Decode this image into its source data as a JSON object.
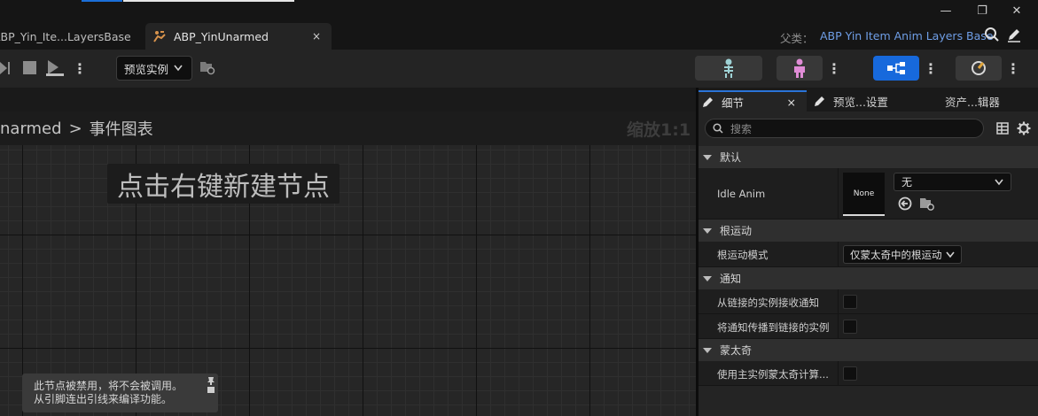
{
  "tabs": [
    {
      "label": "ABP_Yin_Ite...LayersBase"
    },
    {
      "label": "ABP_YinUnarmed",
      "close": "×"
    }
  ],
  "parent_class": {
    "label": "父类：",
    "value": "ABP Yin Item Anim Layers Base"
  },
  "window_controls": {
    "minimize": "—",
    "maximize": "❐",
    "close": "✕"
  },
  "toolbar": {
    "preview_instance": "预览实例"
  },
  "graph": {
    "breadcrumb_asset": "narmed",
    "breadcrumb_sep": ">",
    "breadcrumb_graph": "事件图表",
    "zoom": "缩放1:1",
    "hint": "点击右键新建节点",
    "notice_line1": "此节点被禁用，将不会被调用。",
    "notice_line2": "从引脚连出引线来编译功能。"
  },
  "details_panel": {
    "tabs": [
      {
        "label": "细节",
        "close": "×"
      },
      {
        "label": "预览...设置"
      },
      {
        "label": "资产...辑器"
      }
    ],
    "search_placeholder": "搜索",
    "sections": {
      "default": {
        "title": "默认",
        "idle_anim_label": "Idle Anim",
        "idle_anim_thumb": "None",
        "idle_anim_value": "无"
      },
      "root_motion": {
        "title": "根运动",
        "mode_label": "根运动模式",
        "mode_value": "仅蒙太奇中的根运动"
      },
      "notify": {
        "title": "通知",
        "receive_label": "从链接的实例接收通知",
        "propagate_label": "将通知传播到链接的实例"
      },
      "montage": {
        "title": "蒙太奇",
        "use_main_label": "使用主实例蒙太奇计算..."
      }
    }
  },
  "colors": {
    "accent": "#1b6fd8",
    "link": "#6f9ee6",
    "panel": "#242424",
    "graph": "#262626"
  }
}
